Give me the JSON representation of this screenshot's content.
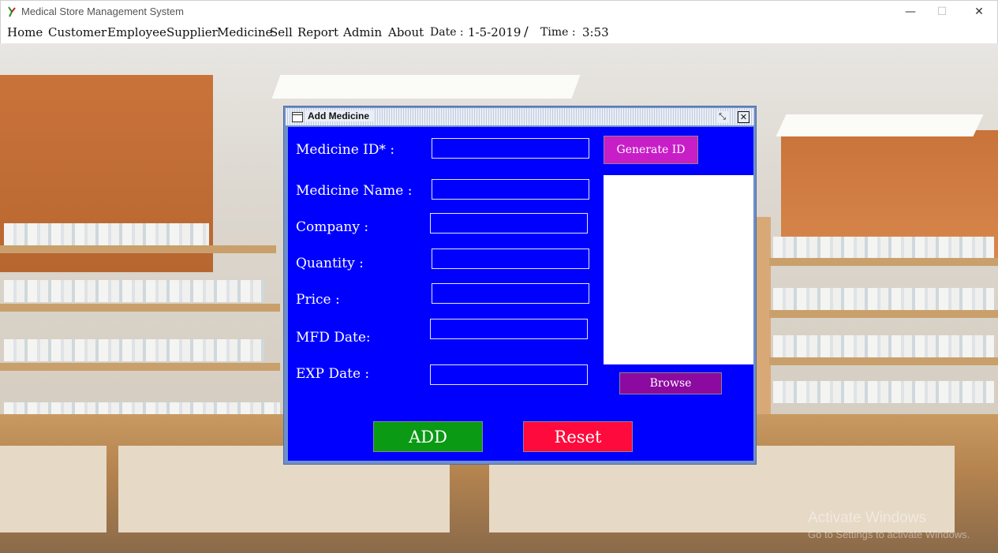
{
  "window": {
    "title": "Medical Store Management System",
    "min_glyph": "—",
    "max_glyph": "☐",
    "close_glyph": "✕"
  },
  "menu": {
    "items": [
      "Home",
      "Customer",
      "Employee",
      "Supplier",
      "Medicine",
      "Sell",
      "Report",
      "Admin",
      "About"
    ],
    "date_label": "Date :",
    "date_value": "1-5-2019",
    "separator": "/",
    "time_label": "Time :",
    "time_value": "3:53"
  },
  "dialog": {
    "title": "Add Medicine",
    "restore_glyph": "⤡",
    "close_glyph": "✕",
    "labels": {
      "medicine_id": "Medicine ID* :",
      "medicine_name": "Medicine Name :",
      "company": "Company :",
      "quantity": "Quantity :",
      "price": "Price :",
      "mfd_date": "MFD Date:",
      "exp_date": "EXP Date :"
    },
    "values": {
      "medicine_id": "",
      "medicine_name": "",
      "company": "",
      "quantity": "",
      "price": "",
      "mfd_date": "",
      "exp_date": ""
    },
    "buttons": {
      "generate_id": "Generate ID",
      "browse": "Browse",
      "add": "ADD",
      "reset": "Reset"
    }
  },
  "watermark": {
    "line1": "Activate Windows",
    "line2": "Go to Settings to activate Windows."
  },
  "colors": {
    "form_bg": "#0000ff",
    "generate_id": "#c81ec8",
    "browse": "#8c0aa0",
    "add": "#0a9a14",
    "reset": "#ff0a3c"
  }
}
